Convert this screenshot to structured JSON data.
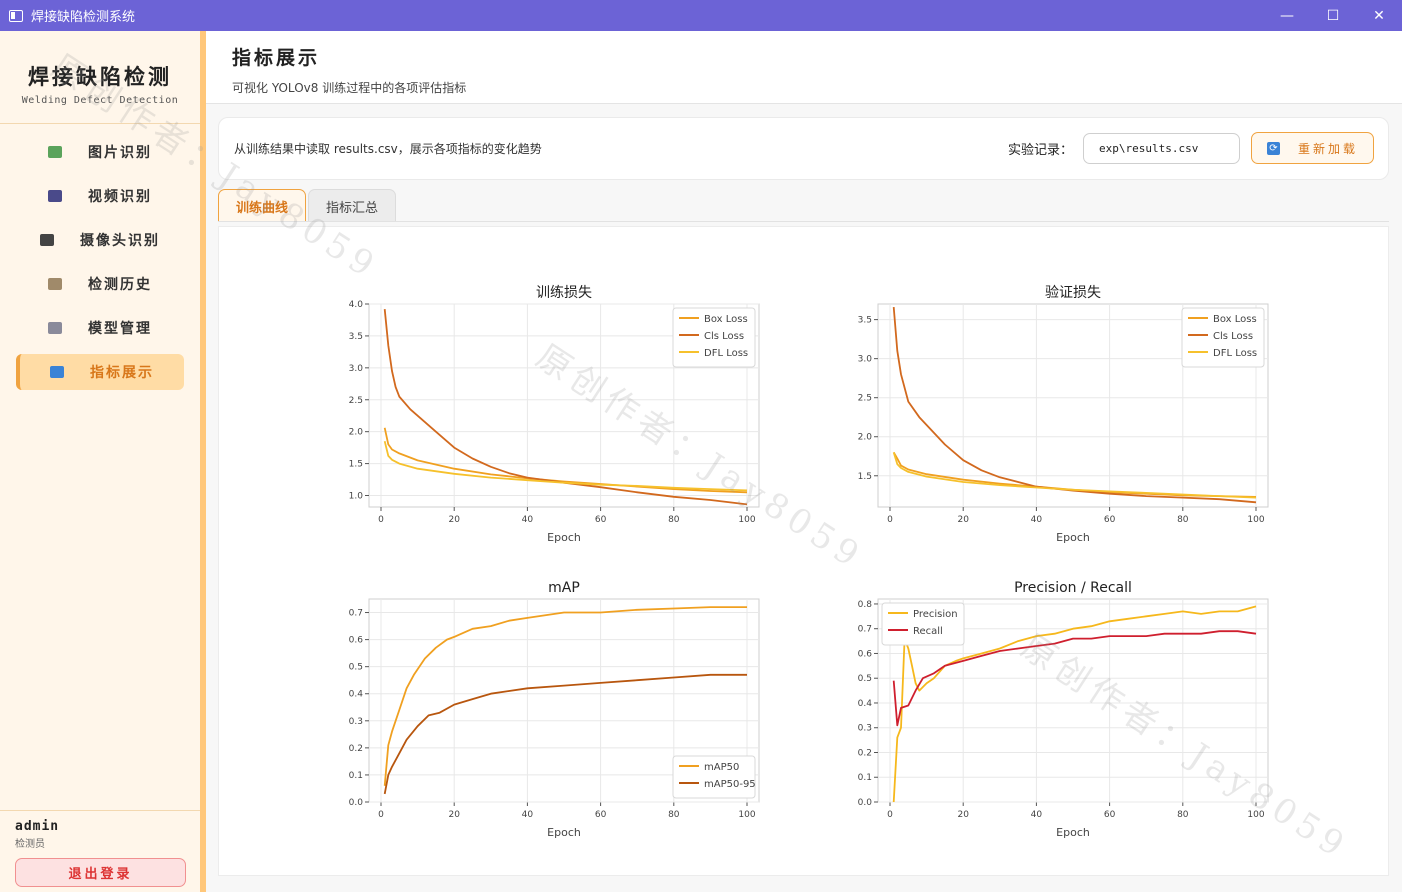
{
  "window": {
    "title": "焊接缺陷检测系统",
    "controls": {
      "minimize": "—",
      "maximize": "☐",
      "close": "✕"
    }
  },
  "sidebar": {
    "brand_cn": "焊接缺陷检测",
    "brand_en": "Welding Defect Detection",
    "items": [
      {
        "label": "图片识别",
        "icon": "image-icon",
        "color": "#5ba35b"
      },
      {
        "label": "视频识别",
        "icon": "clapper-icon",
        "color": "#4a4a8a"
      },
      {
        "label": "摄像头识别",
        "icon": "camera-icon",
        "color": "#444444"
      },
      {
        "label": "检测历史",
        "icon": "clipboard-icon",
        "color": "#a08a6a"
      },
      {
        "label": "模型管理",
        "icon": "gear-icon",
        "color": "#8a8a9a"
      },
      {
        "label": "指标展示",
        "icon": "bar-chart-icon",
        "color": "#3a83d6",
        "active": true
      }
    ],
    "user": {
      "name": "admin",
      "role": "检测员"
    },
    "logout_label": "退出登录"
  },
  "header": {
    "title": "指标展示",
    "subtitle": "可视化 YOLOv8 训练过程中的各项评估指标"
  },
  "toolbar": {
    "description": "从训练结果中读取 results.csv，展示各项指标的变化趋势",
    "record_label": "实验记录：",
    "record_value": "exp\\results.csv",
    "reload_label": "重新加载"
  },
  "tabs": [
    {
      "label": "训练曲线",
      "active": true
    },
    {
      "label": "指标汇总",
      "active": false
    }
  ],
  "watermark": {
    "text": "原创作者：Jay8059"
  },
  "colors": {
    "orange": "#f0a020",
    "dark_orange": "#d2691e",
    "yellow": "#f6c12c",
    "brown": "#b8560e",
    "red": "#cf1f2e"
  },
  "chart_data": [
    {
      "type": "line",
      "title": "训练损失",
      "xlabel": "Epoch",
      "ylabel": "",
      "xlim": [
        0,
        100
      ],
      "ylim": [
        0.82,
        4.0
      ],
      "xticks": [
        0,
        20,
        40,
        60,
        80,
        100
      ],
      "yticks": [
        1.0,
        1.5,
        2.0,
        2.5,
        3.0,
        3.5,
        4.0
      ],
      "legend": "top-right",
      "grid": true,
      "series": [
        {
          "name": "Box Loss",
          "color": "#f0a020",
          "points": [
            [
              1,
              2.06
            ],
            [
              2,
              1.8
            ],
            [
              3,
              1.72
            ],
            [
              5,
              1.66
            ],
            [
              10,
              1.55
            ],
            [
              20,
              1.42
            ],
            [
              30,
              1.33
            ],
            [
              40,
              1.27
            ],
            [
              50,
              1.22
            ],
            [
              60,
              1.18
            ],
            [
              70,
              1.14
            ],
            [
              80,
              1.1
            ],
            [
              90,
              1.07
            ],
            [
              100,
              1.05
            ]
          ]
        },
        {
          "name": "Cls Loss",
          "color": "#d2691e",
          "points": [
            [
              1,
              3.92
            ],
            [
              2,
              3.35
            ],
            [
              3,
              2.95
            ],
            [
              4,
              2.7
            ],
            [
              5,
              2.55
            ],
            [
              8,
              2.35
            ],
            [
              10,
              2.25
            ],
            [
              15,
              2.0
            ],
            [
              20,
              1.75
            ],
            [
              25,
              1.58
            ],
            [
              30,
              1.45
            ],
            [
              35,
              1.35
            ],
            [
              40,
              1.28
            ],
            [
              50,
              1.2
            ],
            [
              60,
              1.13
            ],
            [
              70,
              1.05
            ],
            [
              80,
              0.98
            ],
            [
              90,
              0.93
            ],
            [
              100,
              0.86
            ]
          ]
        },
        {
          "name": "DFL Loss",
          "color": "#f6c12c",
          "points": [
            [
              1,
              1.85
            ],
            [
              2,
              1.62
            ],
            [
              3,
              1.56
            ],
            [
              5,
              1.5
            ],
            [
              10,
              1.42
            ],
            [
              20,
              1.34
            ],
            [
              30,
              1.28
            ],
            [
              40,
              1.24
            ],
            [
              50,
              1.2
            ],
            [
              60,
              1.17
            ],
            [
              70,
              1.15
            ],
            [
              80,
              1.12
            ],
            [
              90,
              1.1
            ],
            [
              100,
              1.08
            ]
          ]
        }
      ]
    },
    {
      "type": "line",
      "title": "验证损失",
      "xlabel": "Epoch",
      "ylabel": "",
      "xlim": [
        0,
        100
      ],
      "ylim": [
        1.1,
        3.7
      ],
      "xticks": [
        0,
        20,
        40,
        60,
        80,
        100
      ],
      "yticks": [
        1.5,
        2.0,
        2.5,
        3.0,
        3.5
      ],
      "legend": "top-right",
      "grid": true,
      "series": [
        {
          "name": "Box Loss",
          "color": "#f0a020",
          "points": [
            [
              1,
              1.8
            ],
            [
              2,
              1.72
            ],
            [
              3,
              1.63
            ],
            [
              5,
              1.58
            ],
            [
              10,
              1.52
            ],
            [
              20,
              1.45
            ],
            [
              30,
              1.4
            ],
            [
              40,
              1.36
            ],
            [
              50,
              1.32
            ],
            [
              60,
              1.29
            ],
            [
              70,
              1.27
            ],
            [
              80,
              1.25
            ],
            [
              90,
              1.24
            ],
            [
              100,
              1.23
            ]
          ]
        },
        {
          "name": "Cls Loss",
          "color": "#d2691e",
          "points": [
            [
              1,
              3.66
            ],
            [
              2,
              3.1
            ],
            [
              3,
              2.8
            ],
            [
              5,
              2.45
            ],
            [
              8,
              2.25
            ],
            [
              10,
              2.15
            ],
            [
              15,
              1.9
            ],
            [
              20,
              1.7
            ],
            [
              25,
              1.57
            ],
            [
              30,
              1.48
            ],
            [
              35,
              1.42
            ],
            [
              40,
              1.36
            ],
            [
              50,
              1.31
            ],
            [
              60,
              1.27
            ],
            [
              70,
              1.24
            ],
            [
              80,
              1.22
            ],
            [
              90,
              1.2
            ],
            [
              100,
              1.16
            ]
          ]
        },
        {
          "name": "DFL Loss",
          "color": "#f6c12c",
          "points": [
            [
              1,
              1.8
            ],
            [
              2,
              1.65
            ],
            [
              3,
              1.6
            ],
            [
              5,
              1.55
            ],
            [
              10,
              1.49
            ],
            [
              20,
              1.42
            ],
            [
              30,
              1.38
            ],
            [
              40,
              1.35
            ],
            [
              50,
              1.32
            ],
            [
              60,
              1.3
            ],
            [
              70,
              1.28
            ],
            [
              80,
              1.26
            ],
            [
              90,
              1.24
            ],
            [
              100,
              1.22
            ]
          ]
        }
      ]
    },
    {
      "type": "line",
      "title": "mAP",
      "xlabel": "Epoch",
      "ylabel": "",
      "xlim": [
        0,
        100
      ],
      "ylim": [
        0.0,
        0.75
      ],
      "xticks": [
        0,
        20,
        40,
        60,
        80,
        100
      ],
      "yticks": [
        0.0,
        0.1,
        0.2,
        0.3,
        0.4,
        0.5,
        0.6,
        0.7
      ],
      "legend": "bottom-right",
      "grid": true,
      "series": [
        {
          "name": "mAP50",
          "color": "#f0a020",
          "points": [
            [
              1,
              0.06
            ],
            [
              2,
              0.21
            ],
            [
              3,
              0.26
            ],
            [
              5,
              0.34
            ],
            [
              7,
              0.42
            ],
            [
              9,
              0.47
            ],
            [
              12,
              0.53
            ],
            [
              15,
              0.57
            ],
            [
              18,
              0.6
            ],
            [
              20,
              0.61
            ],
            [
              25,
              0.64
            ],
            [
              30,
              0.65
            ],
            [
              35,
              0.67
            ],
            [
              40,
              0.68
            ],
            [
              50,
              0.7
            ],
            [
              60,
              0.7
            ],
            [
              70,
              0.71
            ],
            [
              80,
              0.715
            ],
            [
              90,
              0.72
            ],
            [
              100,
              0.72
            ]
          ]
        },
        {
          "name": "mAP50-95",
          "color": "#b8560e",
          "points": [
            [
              1,
              0.03
            ],
            [
              2,
              0.1
            ],
            [
              3,
              0.13
            ],
            [
              5,
              0.18
            ],
            [
              7,
              0.23
            ],
            [
              10,
              0.28
            ],
            [
              13,
              0.32
            ],
            [
              16,
              0.33
            ],
            [
              20,
              0.36
            ],
            [
              25,
              0.38
            ],
            [
              30,
              0.4
            ],
            [
              35,
              0.41
            ],
            [
              40,
              0.42
            ],
            [
              50,
              0.43
            ],
            [
              60,
              0.44
            ],
            [
              70,
              0.45
            ],
            [
              80,
              0.46
            ],
            [
              90,
              0.47
            ],
            [
              100,
              0.47
            ]
          ]
        }
      ]
    },
    {
      "type": "line",
      "title": "Precision / Recall",
      "xlabel": "Epoch",
      "ylabel": "",
      "xlim": [
        0,
        100
      ],
      "ylim": [
        0.0,
        0.82
      ],
      "xticks": [
        0,
        20,
        40,
        60,
        80,
        100
      ],
      "yticks": [
        0.0,
        0.1,
        0.2,
        0.3,
        0.4,
        0.5,
        0.6,
        0.7,
        0.8
      ],
      "legend": "top-left",
      "grid": true,
      "series": [
        {
          "name": "Precision",
          "color": "#f6b81c",
          "points": [
            [
              1,
              0.0
            ],
            [
              2,
              0.26
            ],
            [
              3,
              0.3
            ],
            [
              4,
              0.66
            ],
            [
              5,
              0.62
            ],
            [
              6,
              0.55
            ],
            [
              7,
              0.48
            ],
            [
              8,
              0.45
            ],
            [
              10,
              0.48
            ],
            [
              12,
              0.5
            ],
            [
              15,
              0.55
            ],
            [
              18,
              0.57
            ],
            [
              20,
              0.58
            ],
            [
              25,
              0.6
            ],
            [
              30,
              0.62
            ],
            [
              35,
              0.65
            ],
            [
              40,
              0.67
            ],
            [
              45,
              0.68
            ],
            [
              50,
              0.7
            ],
            [
              55,
              0.71
            ],
            [
              60,
              0.73
            ],
            [
              65,
              0.74
            ],
            [
              70,
              0.75
            ],
            [
              75,
              0.76
            ],
            [
              80,
              0.77
            ],
            [
              85,
              0.76
            ],
            [
              90,
              0.77
            ],
            [
              95,
              0.77
            ],
            [
              100,
              0.79
            ]
          ]
        },
        {
          "name": "Recall",
          "color": "#cf1f2e",
          "points": [
            [
              1,
              0.49
            ],
            [
              2,
              0.31
            ],
            [
              3,
              0.38
            ],
            [
              5,
              0.39
            ],
            [
              7,
              0.45
            ],
            [
              9,
              0.5
            ],
            [
              12,
              0.52
            ],
            [
              15,
              0.55
            ],
            [
              20,
              0.57
            ],
            [
              25,
              0.59
            ],
            [
              30,
              0.61
            ],
            [
              35,
              0.62
            ],
            [
              40,
              0.63
            ],
            [
              45,
              0.64
            ],
            [
              50,
              0.66
            ],
            [
              55,
              0.66
            ],
            [
              60,
              0.67
            ],
            [
              65,
              0.67
            ],
            [
              70,
              0.67
            ],
            [
              75,
              0.68
            ],
            [
              80,
              0.68
            ],
            [
              85,
              0.68
            ],
            [
              90,
              0.69
            ],
            [
              95,
              0.69
            ],
            [
              100,
              0.68
            ]
          ]
        }
      ]
    }
  ]
}
